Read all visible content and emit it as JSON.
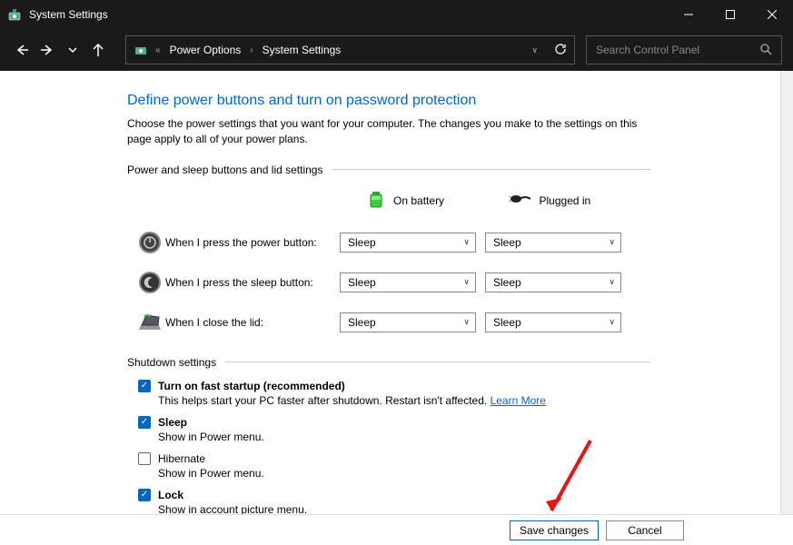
{
  "app": {
    "title": "System Settings"
  },
  "nav": {
    "breadcrumb1": "Power Options",
    "breadcrumb2": "System Settings",
    "search_placeholder": "Search Control Panel"
  },
  "page": {
    "heading": "Define power buttons and turn on password protection",
    "description": "Choose the power settings that you want for your computer. The changes you make to the settings on this page apply to all of your power plans.",
    "section1": "Power and sleep buttons and lid settings",
    "col_battery": "On battery",
    "col_plugged": "Plugged in",
    "rows": {
      "power_button": {
        "label": "When I press the power button:",
        "battery": "Sleep",
        "plugged": "Sleep"
      },
      "sleep_button": {
        "label": "When I press the sleep button:",
        "battery": "Sleep",
        "plugged": "Sleep"
      },
      "lid": {
        "label": "When I close the lid:",
        "battery": "Sleep",
        "plugged": "Sleep"
      }
    },
    "section2": "Shutdown settings",
    "shutdown": {
      "fast_startup": {
        "label": "Turn on fast startup (recommended)",
        "desc": "This helps start your PC faster after shutdown. Restart isn't affected. ",
        "link": "Learn More",
        "checked": true
      },
      "sleep": {
        "label": "Sleep",
        "desc": "Show in Power menu.",
        "checked": true
      },
      "hibernate": {
        "label": "Hibernate",
        "desc": "Show in Power menu.",
        "checked": false
      },
      "lock": {
        "label": "Lock",
        "desc": "Show in account picture menu.",
        "checked": true
      }
    }
  },
  "footer": {
    "save": "Save changes",
    "cancel": "Cancel"
  }
}
